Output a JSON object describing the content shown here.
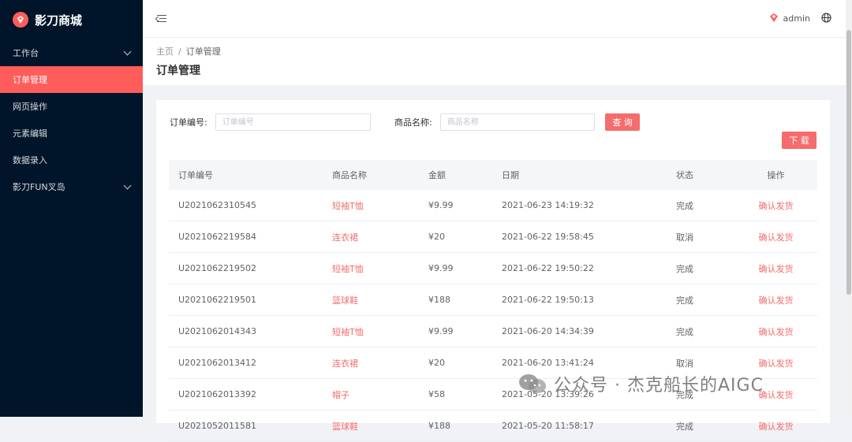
{
  "app": {
    "title": "影刀商城"
  },
  "sidebar": {
    "items": [
      {
        "label": "工作台",
        "has_children": true,
        "active": false
      },
      {
        "label": "订单管理",
        "has_children": false,
        "active": true
      },
      {
        "label": "网页操作",
        "has_children": false,
        "active": false
      },
      {
        "label": "元素编辑",
        "has_children": false,
        "active": false
      },
      {
        "label": "数据录入",
        "has_children": false,
        "active": false
      },
      {
        "label": "影刀FUN叉岛",
        "has_children": true,
        "active": false
      }
    ]
  },
  "header": {
    "username": "admin",
    "icons": [
      "menu-fold-icon",
      "user-logo-icon",
      "globe-icon"
    ]
  },
  "breadcrumb": {
    "home": "主页",
    "separator": "/",
    "current": "订单管理"
  },
  "page": {
    "title": "订单管理"
  },
  "filters": {
    "order_label": "订单编号:",
    "order_placeholder": "订单编号",
    "product_label": "商品名称:",
    "product_placeholder": "商品名称",
    "search_button": "查 询",
    "download_button": "下 载"
  },
  "table": {
    "columns": [
      "订单编号",
      "商品名称",
      "金额",
      "日期",
      "状态",
      "操作"
    ],
    "rows": [
      {
        "order_id": "U2021062310545",
        "product": "短袖T恤",
        "amount": "¥9.99",
        "date": "2021-06-23 14:19:32",
        "status": "完成",
        "action": "确认发货"
      },
      {
        "order_id": "U2021062219584",
        "product": "连衣裙",
        "amount": "¥20",
        "date": "2021-06-22 19:58:45",
        "status": "取消",
        "action": "确认发货"
      },
      {
        "order_id": "U2021062219502",
        "product": "短袖T恤",
        "amount": "¥9.99",
        "date": "2021-06-22 19:50:22",
        "status": "完成",
        "action": "确认发货"
      },
      {
        "order_id": "U2021062219501",
        "product": "篮球鞋",
        "amount": "¥188",
        "date": "2021-06-22 19:50:13",
        "status": "完成",
        "action": "确认发货"
      },
      {
        "order_id": "U2021062014343",
        "product": "短袖T恤",
        "amount": "¥9.99",
        "date": "2021-06-20 14:34:39",
        "status": "完成",
        "action": "确认发货"
      },
      {
        "order_id": "U2021062013412",
        "product": "连衣裙",
        "amount": "¥20",
        "date": "2021-06-20 13:41:24",
        "status": "取消",
        "action": "确认发货"
      },
      {
        "order_id": "U2021062013392",
        "product": "帽子",
        "amount": "¥58",
        "date": "2021-05-20 13:39:26",
        "status": "完成",
        "action": "确认发货"
      },
      {
        "order_id": "U2021052011581",
        "product": "篮球鞋",
        "amount": "¥188",
        "date": "2021-05-20 11:58:17",
        "status": "完成",
        "action": "确认发货"
      }
    ]
  },
  "watermark": {
    "text": "公众号 · 杰克船长的AIGC"
  },
  "colors": {
    "sidebar_bg": "#001529",
    "accent": "#f56c6c",
    "active_menu": "#ff5c5c"
  }
}
